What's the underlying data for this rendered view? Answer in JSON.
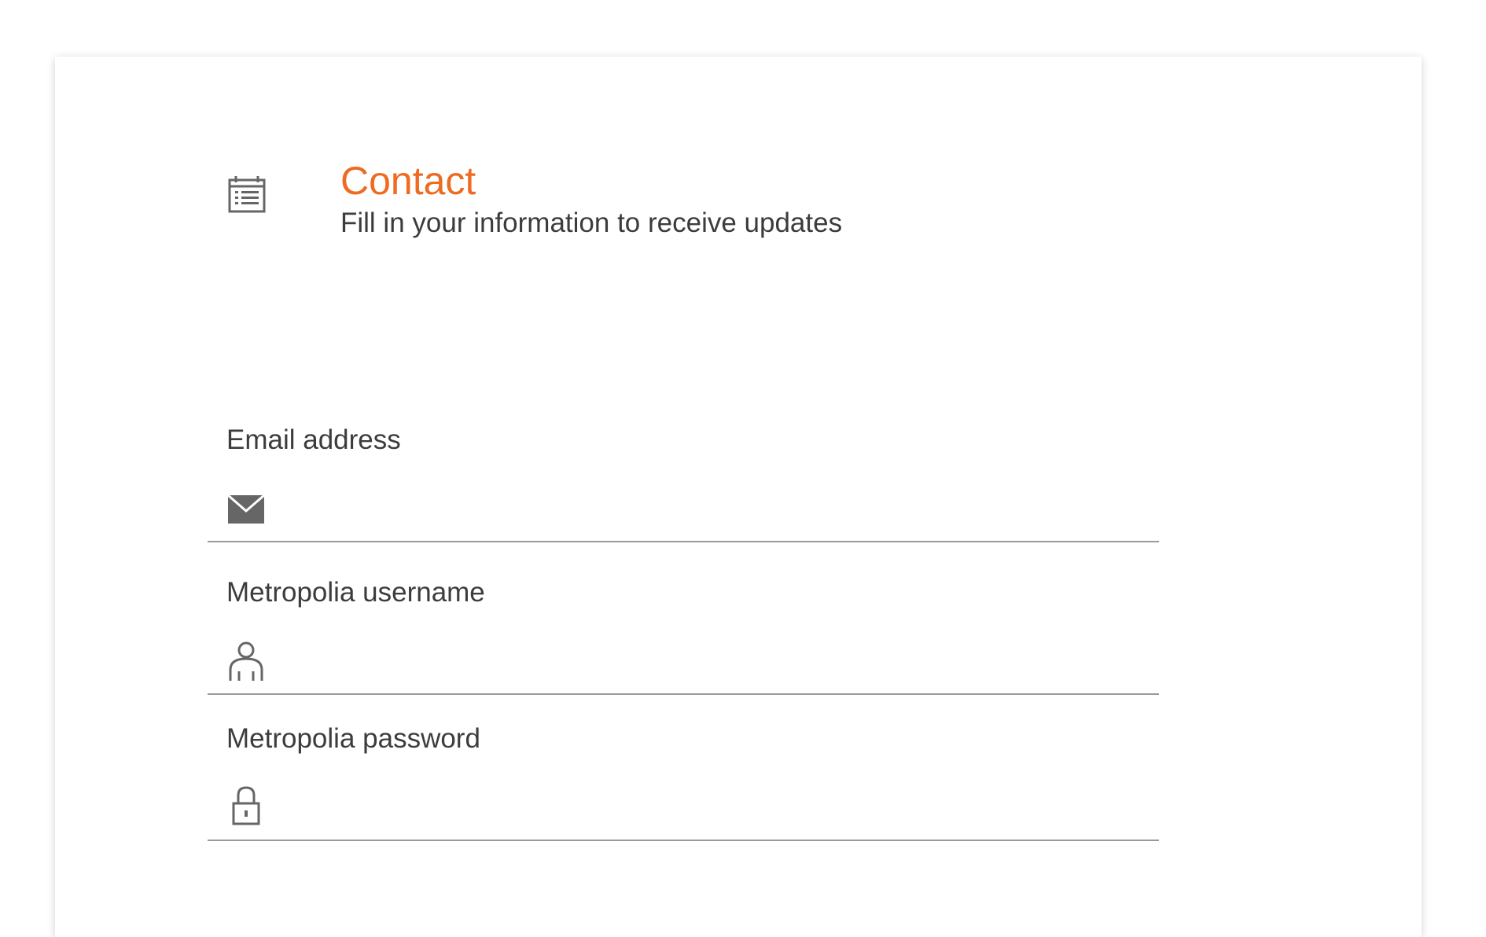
{
  "header": {
    "icon": "calendar-list-icon",
    "title": "Contact",
    "subtitle": "Fill in your information to receive updates"
  },
  "form": {
    "fields": [
      {
        "label": "Email address",
        "icon": "envelope-icon",
        "value": "",
        "placeholder": ""
      },
      {
        "label": "Metropolia username",
        "icon": "person-icon",
        "value": "",
        "placeholder": ""
      },
      {
        "label": "Metropolia password",
        "icon": "lock-icon",
        "value": "",
        "placeholder": ""
      }
    ]
  },
  "colors": {
    "accent": "#ee6b22",
    "text": "#3c3c3c",
    "icon": "#666666",
    "underline": "#9a9a9a"
  }
}
